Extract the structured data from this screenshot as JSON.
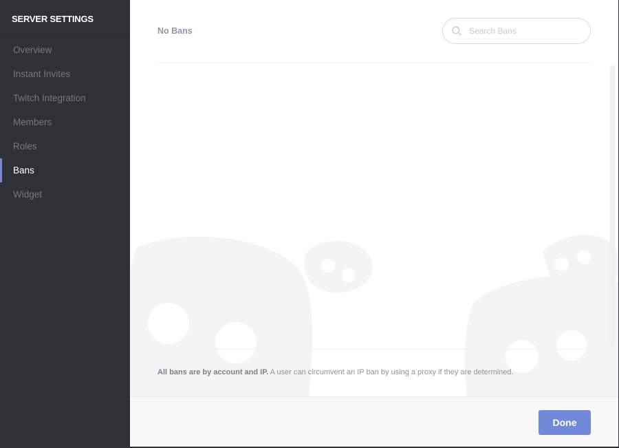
{
  "sidebar": {
    "title": "SERVER SETTINGS",
    "items": [
      {
        "label": "Overview"
      },
      {
        "label": "Instant Invites"
      },
      {
        "label": "Twitch Integration"
      },
      {
        "label": "Members"
      },
      {
        "label": "Roles"
      },
      {
        "label": "Bans",
        "active": true
      },
      {
        "label": "Widget"
      }
    ]
  },
  "main": {
    "status_text": "No Bans",
    "search": {
      "placeholder": "Search Bans",
      "value": "",
      "icon": "search-icon"
    },
    "notice": {
      "bold": "All bans are by account and IP.",
      "text": " A user can circumvent an IP ban by using a proxy if they are determined."
    }
  },
  "footer": {
    "done_label": "Done"
  },
  "colors": {
    "sidebar_bg": "#2e3136",
    "accent": "#7289da",
    "nav_inactive": "#75787d",
    "status_text": "#8a9aab"
  }
}
